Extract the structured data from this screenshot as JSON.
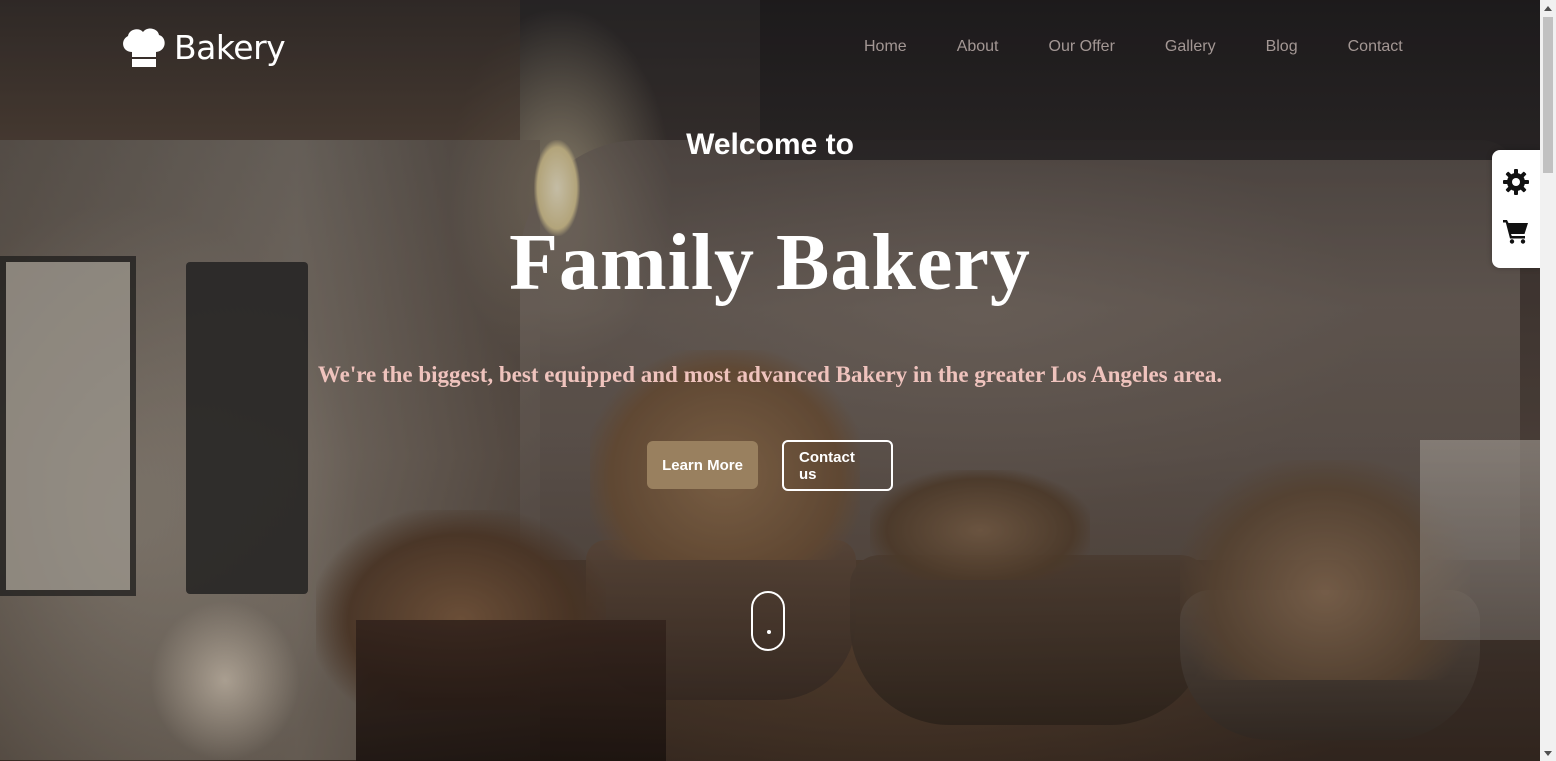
{
  "header": {
    "logo_text": "Bakery",
    "logo_icon": "chef-hat-icon",
    "nav": [
      {
        "label": "Home"
      },
      {
        "label": "About"
      },
      {
        "label": "Our Offer"
      },
      {
        "label": "Gallery"
      },
      {
        "label": "Blog"
      },
      {
        "label": "Contact"
      }
    ]
  },
  "hero": {
    "welcome": "Welcome to",
    "title": "Family Bakery",
    "subtitle": "We're the biggest, best equipped and most advanced Bakery in the greater Los Angeles area.",
    "learn_more": "Learn More",
    "contact_us": "Contact us",
    "scroll_icon": "mouse-scroll-icon"
  },
  "side_widget": {
    "settings_icon": "gear-icon",
    "cart_icon": "cart-icon"
  },
  "colors": {
    "primary_button": "#99805f",
    "subtitle": "#efc3bd",
    "nav_text": "#a39794"
  }
}
